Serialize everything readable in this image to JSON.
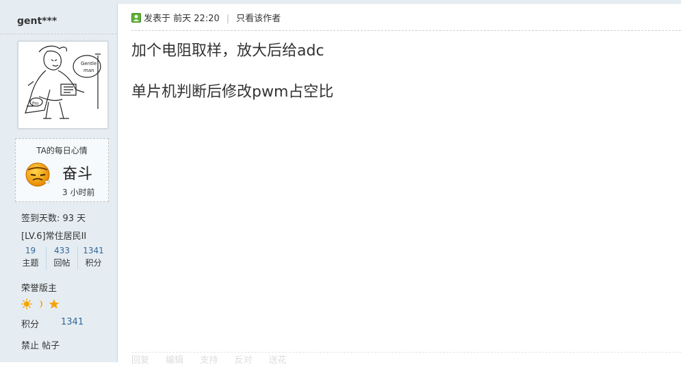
{
  "sidebar": {
    "username": "gent***",
    "mood": {
      "title": "TA的每日心情",
      "text": "奋斗",
      "time": "3 小时前"
    },
    "checkin": "签到天数: 93 天",
    "level": "[LV.6]常住居民II",
    "stats": [
      {
        "value": "19",
        "label": "主题"
      },
      {
        "value": "433",
        "label": "回帖"
      },
      {
        "value": "1341",
        "label": "积分"
      }
    ],
    "honor": "荣誉版主",
    "medals": [
      "sun-icon",
      "moon-icon",
      "star-icon"
    ],
    "credits_label": "积分",
    "credits_value": "1341",
    "banned": "禁止 帖子"
  },
  "post": {
    "posted_prefix": "发表于",
    "posted_time": "前天 22:20",
    "author_only": "只看该作者",
    "content": [
      "加个电阻取样，放大后给adc",
      "单片机判断后修改pwm占空比"
    ]
  },
  "actions": [
    "回复",
    "编辑",
    "支持",
    "反对",
    "送花"
  ],
  "colors": {
    "sidebar_bg": "#e5edf2",
    "link": "#336699",
    "medal": "#f7a300"
  }
}
